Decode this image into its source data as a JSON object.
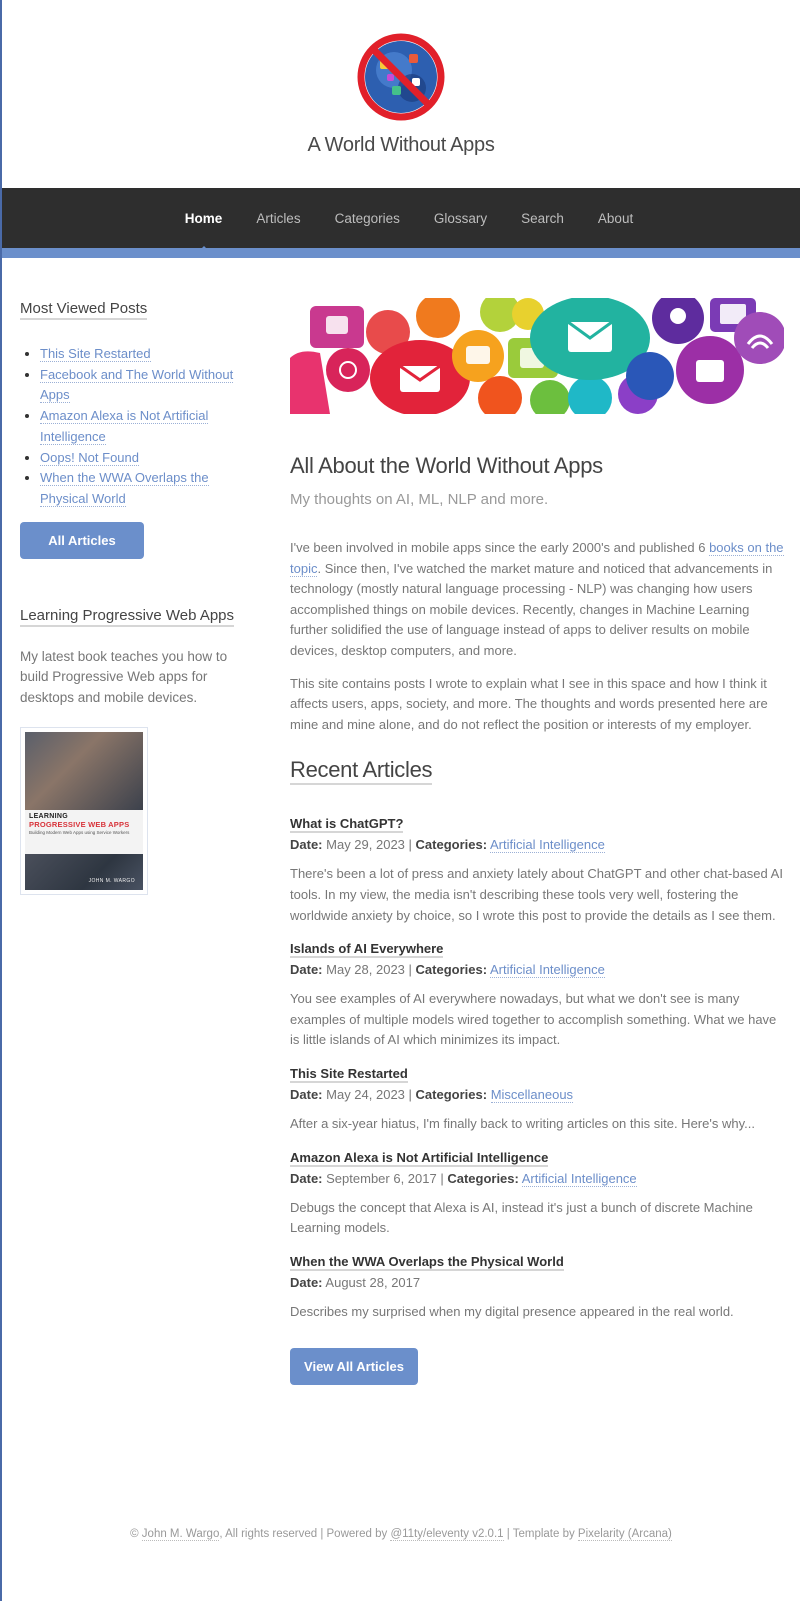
{
  "site": {
    "title": "A World Without Apps"
  },
  "nav": {
    "items": [
      "Home",
      "Articles",
      "Categories",
      "Glossary",
      "Search",
      "About"
    ],
    "active": "Home"
  },
  "sidebar": {
    "most_viewed_heading": "Most Viewed Posts",
    "most_viewed": [
      "This Site Restarted",
      "Facebook and The World Without Apps",
      "Amazon Alexa is Not Artificial Intelligence",
      "Oops! Not Found",
      "When the WWA Overlaps the Physical World"
    ],
    "all_articles_label": "All Articles",
    "book_heading": "Learning Progressive Web Apps",
    "book_text": "My latest book teaches you how to build Progressive Web apps for desktops and mobile devices.",
    "book_cover": {
      "line1": "LEARNING",
      "line2": "PROGRESSIVE WEB APPS",
      "line3": "Building Modern Web Apps using Service Workers",
      "author": "JOHN M. WARGO"
    }
  },
  "main": {
    "title": "All About the World Without Apps",
    "subtitle": "My thoughts on AI, ML, NLP and more.",
    "intro1_before": "I've been involved in mobile apps since the early 2000's and published 6 ",
    "intro1_link": "books on the topic",
    "intro1_after": ". Since then, I've watched the market mature and noticed that advancements in technology (mostly natural language processing - NLP) was changing how users accomplished things on mobile devices. Recently, changes in Machine Learning further solidified the use of language instead of apps to deliver results on mobile devices, desktop computers, and more.",
    "intro2": "This site contains posts I wrote to explain what I see in this space and how I think it affects users, apps, society, and more. The thoughts and words presented here are mine and mine alone, and do not reflect the position or interests of my employer.",
    "recent_heading": "Recent Articles",
    "date_label": "Date:",
    "categories_label": "Categories:",
    "articles": [
      {
        "title": "What is ChatGPT?",
        "date": "May 29, 2023",
        "category": "Artificial Intelligence",
        "summary": "There's been a lot of press and anxiety lately about ChatGPT and other chat-based AI tools. In my view, the media isn't describing these tools very well, fostering the worldwide anxiety by choice, so I wrote this post to provide the details as I see them."
      },
      {
        "title": "Islands of AI Everywhere",
        "date": "May 28, 2023",
        "category": "Artificial Intelligence",
        "summary": "You see examples of AI everywhere nowadays, but what we don't see is many examples of multiple models wired together to accomplish something. What we have is little islands of AI which minimizes its impact."
      },
      {
        "title": "This Site Restarted",
        "date": "May 24, 2023",
        "category": "Miscellaneous",
        "summary": "After a six-year hiatus, I'm finally back to writing articles on this site. Here's why..."
      },
      {
        "title": "Amazon Alexa is Not Artificial Intelligence",
        "date": "September 6, 2017",
        "category": "Artificial Intelligence",
        "summary": "Debugs the concept that Alexa is AI, instead it's just a bunch of discrete Machine Learning models."
      },
      {
        "title": "When the WWA Overlaps the Physical World",
        "date": "August 28, 2017",
        "category": "",
        "summary": "Describes my surprised when my digital presence appeared in the real world."
      }
    ],
    "view_all_label": "View All Articles"
  },
  "footer": {
    "copyright": "© ",
    "author_link": "John M. Wargo",
    "rights": ", All rights reserved | Powered by ",
    "powered_link": "@11ty/eleventy v2.0.1",
    "template_text": " | Template by ",
    "template_link": "Pixelarity (Arcana)"
  },
  "colors": {
    "accent": "#6b8fcb",
    "nav_bg": "#2e2e2e",
    "link": "#6c8ec9"
  }
}
